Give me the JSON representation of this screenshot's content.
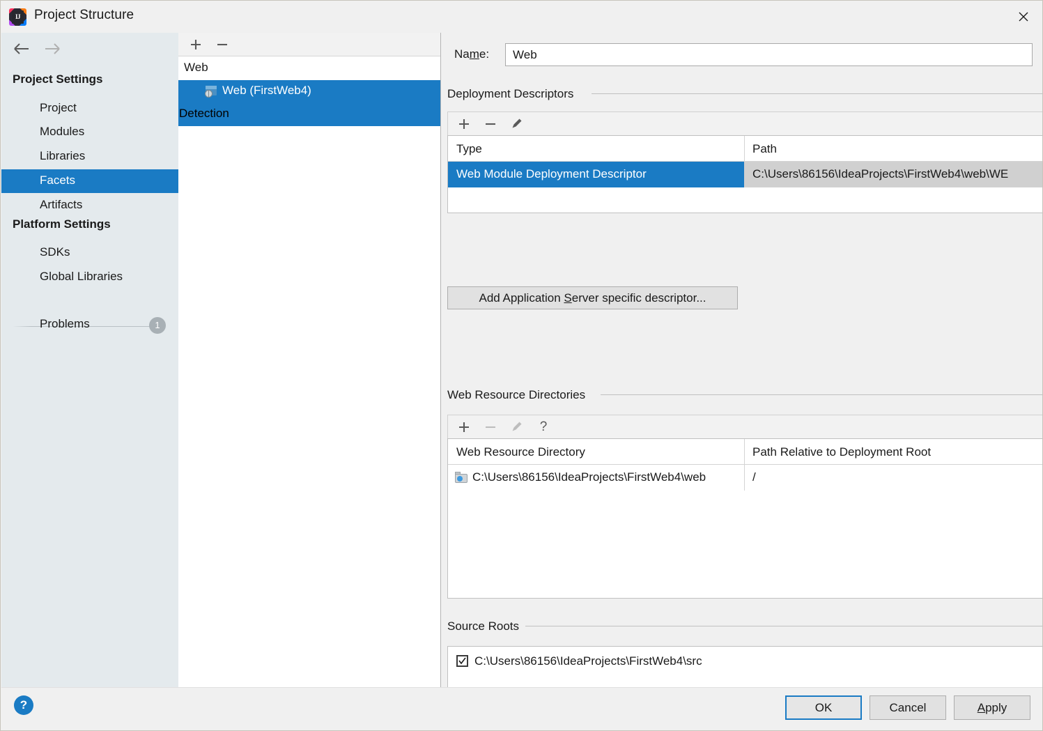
{
  "window": {
    "title": "Project Structure",
    "app_icon": "intellij-idea-logo",
    "close_icon": "close-icon"
  },
  "sidebar": {
    "back_icon": "arrow-left-icon",
    "forward_icon": "arrow-right-icon",
    "sections": [
      {
        "title": "Project Settings",
        "items": [
          {
            "label": "Project",
            "selected": false
          },
          {
            "label": "Modules",
            "selected": false
          },
          {
            "label": "Libraries",
            "selected": false
          },
          {
            "label": "Facets",
            "selected": true
          },
          {
            "label": "Artifacts",
            "selected": false
          }
        ]
      },
      {
        "title": "Platform Settings",
        "items": [
          {
            "label": "SDKs",
            "selected": false
          },
          {
            "label": "Global Libraries",
            "selected": false
          }
        ]
      }
    ],
    "problems": {
      "label": "Problems",
      "count": "1"
    },
    "selected_accent": "#1a7bc4",
    "background": "#e4eaed"
  },
  "tree_panel": {
    "toolbar": {
      "add_icon": "plus-icon",
      "remove_icon": "minus-icon"
    },
    "rows": [
      {
        "label": "Web",
        "state": "normal",
        "icon": "none"
      },
      {
        "label": "Web (FirstWeb4)",
        "state": "selected",
        "icon": "web-facet-icon"
      },
      {
        "label": "Detection",
        "state": "highlighted",
        "icon": "none"
      }
    ]
  },
  "main": {
    "name": {
      "label_prefix": "Na",
      "label_mnemonic": "m",
      "label_suffix": "e:",
      "value": "Web"
    },
    "deployment_descriptors": {
      "title": "Deployment Descriptors",
      "toolbar": {
        "add_icon": "plus-icon",
        "remove_icon": "minus-icon",
        "edit_icon": "pencil-icon"
      },
      "columns": [
        "Type",
        "Path"
      ],
      "rows": [
        {
          "type": "Web Module Deployment Descriptor",
          "path": "C:\\Users\\86156\\IdeaProjects\\FirstWeb4\\web\\WE",
          "selected": true
        }
      ],
      "add_button": {
        "prefix": "Add Application ",
        "mnemonic": "S",
        "suffix": "erver specific descriptor..."
      }
    },
    "web_resource_directories": {
      "title": "Web Resource Directories",
      "toolbar": {
        "add_icon": "plus-icon",
        "remove_icon": "minus-icon",
        "edit_icon": "pencil-icon",
        "help_icon": "question-mark-icon"
      },
      "columns": [
        "Web Resource Directory",
        "Path Relative to Deployment Root"
      ],
      "rows": [
        {
          "directory": "C:\\Users\\86156\\IdeaProjects\\FirstWeb4\\web",
          "relative_path": "/",
          "icon": "folder-icon"
        }
      ]
    },
    "source_roots": {
      "title": "Source Roots",
      "rows": [
        {
          "path": "C:\\Users\\86156\\IdeaProjects\\FirstWeb4\\src",
          "checked": true
        }
      ]
    }
  },
  "footer": {
    "help_label": "?",
    "ok_label": "OK",
    "cancel_label": "Cancel",
    "apply_prefix": "",
    "apply_mnemonic": "A",
    "apply_suffix": "pply"
  }
}
